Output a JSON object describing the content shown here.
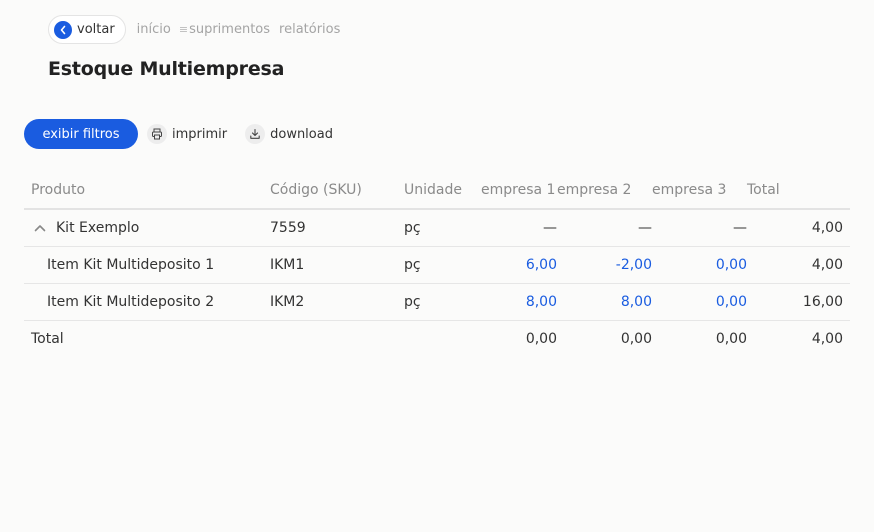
{
  "nav": {
    "back_label": "voltar",
    "breadcrumbs": [
      {
        "label": "início"
      },
      {
        "label": "suprimentos"
      },
      {
        "label": "relatórios"
      }
    ]
  },
  "page": {
    "title": "Estoque Multiempresa"
  },
  "actions": {
    "filter_label": "exibir filtros",
    "print_label": "imprimir",
    "download_label": "download"
  },
  "table": {
    "headers": {
      "product": "Produto",
      "sku": "Código (SKU)",
      "unit": "Unidade",
      "empresa1": "empresa 1",
      "empresa2": "empresa 2",
      "empresa3": "empresa 3",
      "total": "Total"
    },
    "rows": [
      {
        "product": "Kit Exemplo",
        "sku": "7559",
        "unit": "pç",
        "empresa1": "—",
        "empresa2": "—",
        "empresa3": "—",
        "total": "4,00"
      },
      {
        "product": "Item Kit Multideposito 1",
        "sku": "IKM1",
        "unit": "pç",
        "empresa1": "6,00",
        "empresa2": "-2,00",
        "empresa3": "0,00",
        "total": "4,00"
      },
      {
        "product": "Item Kit Multideposito 2",
        "sku": "IKM2",
        "unit": "pç",
        "empresa1": "8,00",
        "empresa2": "8,00",
        "empresa3": "0,00",
        "total": "16,00"
      }
    ],
    "totals": {
      "label": "Total",
      "empresa1": "0,00",
      "empresa2": "0,00",
      "empresa3": "0,00",
      "total": "4,00"
    }
  },
  "colors": {
    "accent": "#1a5ce0",
    "background": "#fbfbfa"
  },
  "icons": {
    "back": "chevron-left-icon",
    "crumb_separator": "menu-lines-icon",
    "print": "printer-icon",
    "download": "download-icon",
    "collapse": "chevron-up-icon"
  }
}
